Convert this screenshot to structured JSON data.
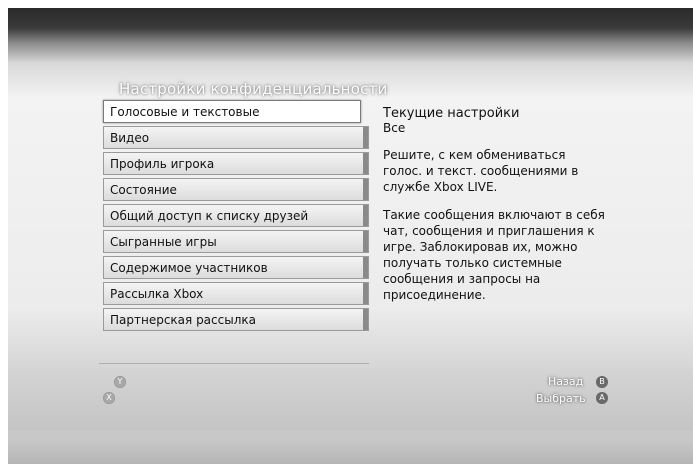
{
  "title": "Настройки конфиденциальности",
  "menu": {
    "items": [
      {
        "label": "Голосовые и текстовые"
      },
      {
        "label": "Видео"
      },
      {
        "label": "Профиль игрока"
      },
      {
        "label": "Состояние"
      },
      {
        "label": "Общий доступ к списку друзей"
      },
      {
        "label": "Сыгранные игры"
      },
      {
        "label": "Содержимое участников"
      },
      {
        "label": "Рассылка Xbox"
      },
      {
        "label": "Партнерская рассылка"
      }
    ]
  },
  "panel": {
    "current_title": "Текущие настройки",
    "current_value": "Все",
    "description1": "Решите, с кем обмениваться голос. и текст. сообщениями в службе Xbox LIVE.",
    "description2": "Такие сообщения включают в себя чат, сообщения и приглашения к игре. Заблокировав их, можно получать только системные сообщения и запросы на присоединение."
  },
  "footer": {
    "y_glyph": "Y",
    "x_glyph": "X",
    "back_label": "Назад",
    "back_glyph": "B",
    "select_label": "Выбрать",
    "select_glyph": "A"
  }
}
